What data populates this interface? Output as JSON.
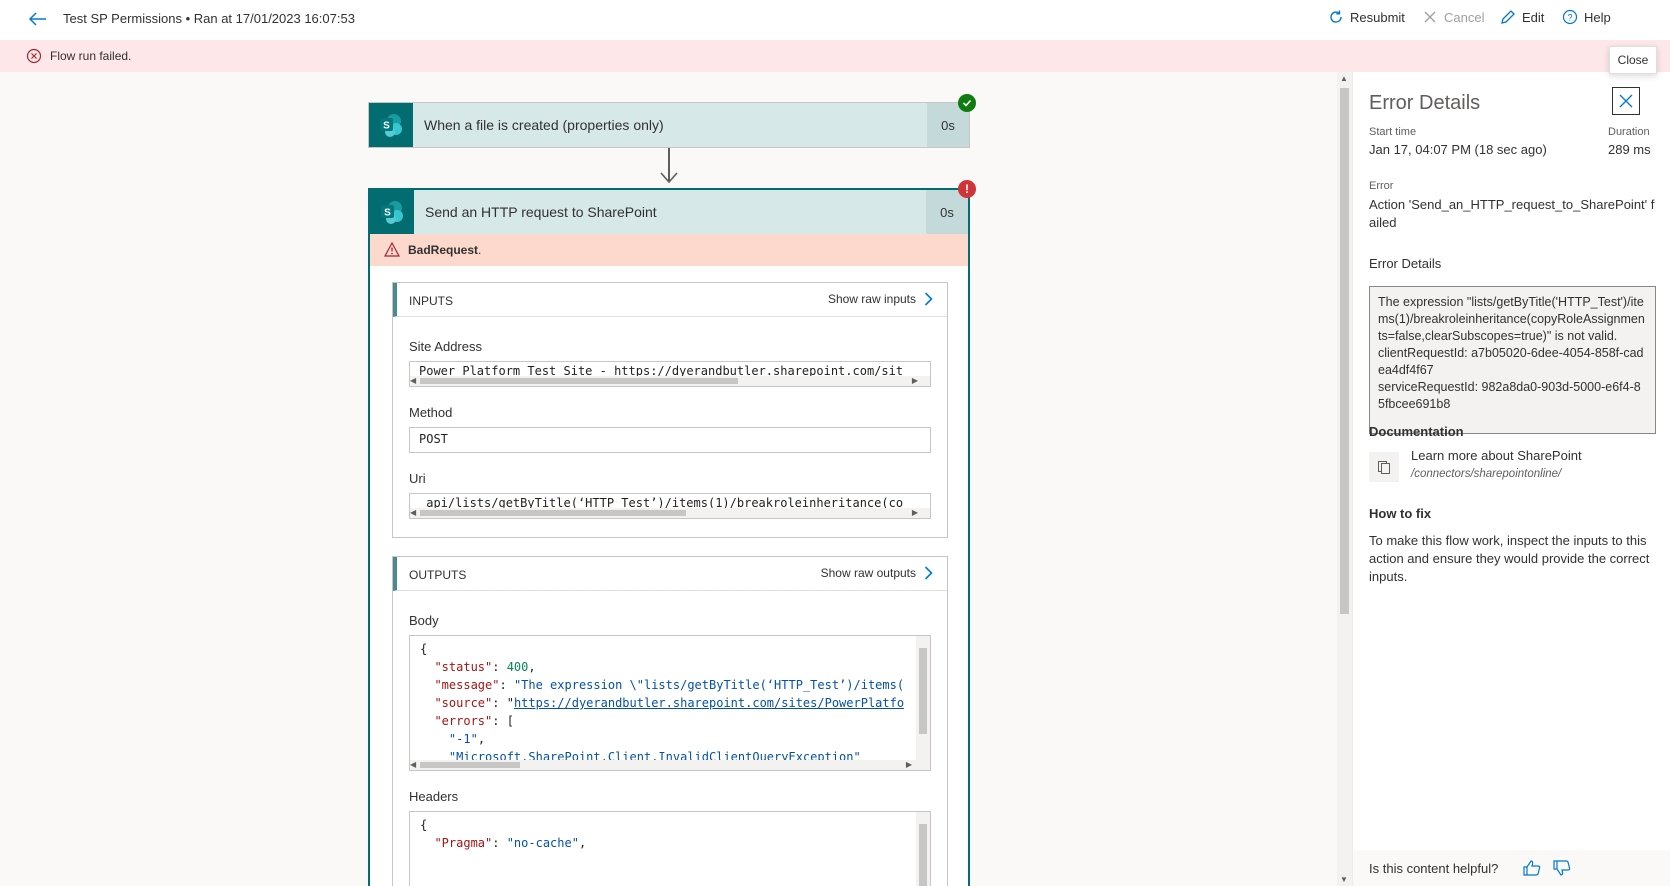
{
  "header": {
    "title": "Test SP Permissions • Ran at 17/01/2023 16:07:53",
    "resubmit": "Resubmit",
    "cancel": "Cancel",
    "edit": "Edit",
    "help": "Help"
  },
  "banner": {
    "text": "Flow run failed."
  },
  "trigger": {
    "title": "When a file is created (properties only)",
    "duration": "0s"
  },
  "action": {
    "title": "Send an HTTP request to SharePoint",
    "duration": "0s",
    "error": "BadRequest",
    "error_suffix": ".",
    "inputs": {
      "heading": "INPUTS",
      "raw_label": "Show raw inputs",
      "site_address_label": "Site Address",
      "site_address_prefix": "Power Platform Test Site - ",
      "site_address_link": "https://dyerandbutler.sharepoint.com/sit",
      "method_label": "Method",
      "method_value": "POST",
      "uri_label": "Uri",
      "uri_value": "_api/lists/getByTitle(‘HTTP_Test’)/items(1)/breakroleinheritance(co"
    },
    "outputs": {
      "heading": "OUTPUTS",
      "raw_label": "Show raw outputs",
      "body_label": "Body",
      "body": {
        "open": "{",
        "status_key": "\"status\"",
        "status_val": "400",
        "message_key": "\"message\"",
        "message_val": "\"The expression \\\"lists/getByTitle(‘HTTP_Test’)/items(",
        "source_key": "\"source\"",
        "source_val": "https://dyerandbutler.sharepoint.com/sites/PowerPlatfo",
        "errors_key": "\"errors\"",
        "errors_open": "[",
        "err1": "\"-1\"",
        "err2": "\"Microsoft.SharePoint.Client.InvalidClientQueryException\""
      },
      "headers_label": "Headers",
      "headers": {
        "open": "{",
        "pragma_key": "\"Pragma\"",
        "pragma_val": "\"no-cache\""
      }
    }
  },
  "panel": {
    "title": "Error Details",
    "close_tooltip": "Close",
    "start_time_label": "Start time",
    "start_time": "Jan 17, 04:07 PM (18 sec ago)",
    "duration_label": "Duration",
    "duration": "289 ms",
    "error_label": "Error",
    "error_text": "Action 'Send_an_HTTP_request_to_SharePoint' failed",
    "error_details_label": "Error Details",
    "error_details": "The expression \"lists/getByTitle('HTTP_Test')/items(1)/breakroleinheritance(copyRoleAssignments=false,clearSubscopes=true)\" is not valid.\nclientRequestId: a7b05020-6dee-4054-858f-cadea4df4f67\nserviceRequestId: 982a8da0-903d-5000-e6f4-85fbcee691b8",
    "documentation_label": "Documentation",
    "doc_title": "Learn more about SharePoint",
    "doc_path": "/connectors/sharepointonline/",
    "how_to_fix_label": "How to fix",
    "how_to_fix": "To make this flow work, inspect the inputs to this action and ensure they would provide the correct inputs.",
    "feedback": "Is this content helpful?"
  },
  "colors": {
    "accent": "#0078d4",
    "sharepoint": "#036c70",
    "success": "#107c10",
    "error": "#d13438",
    "banner_bg": "#fde7e9",
    "bad_request_bg": "#fcd9cc"
  }
}
